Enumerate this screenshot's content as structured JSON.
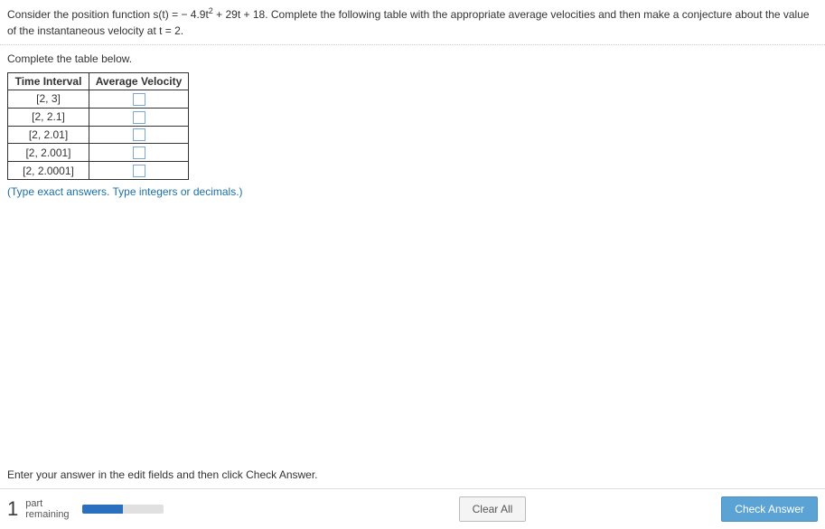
{
  "question": {
    "text_before_sup": "Consider the position function s(t) = − 4.9t",
    "sup": "2",
    "text_after_sup": " + 29t + 18. Complete the following table with the appropriate average velocities and then make a conjecture about the value of the instantaneous velocity at t = 2."
  },
  "instruction": "Complete the table below.",
  "table": {
    "headers": [
      "Time Interval",
      "Average Velocity"
    ],
    "rows": [
      {
        "interval": "[2, 3]"
      },
      {
        "interval": "[2, 2.1]"
      },
      {
        "interval": "[2, 2.01]"
      },
      {
        "interval": "[2, 2.001]"
      },
      {
        "interval": "[2, 2.0001]"
      }
    ]
  },
  "hint": "(Type exact answers. Type integers or decimals.)",
  "footer": {
    "enter_hint": "Enter your answer in the edit fields and then click Check Answer.",
    "part_number": "1",
    "part_label_top": "part",
    "part_label_bottom": "remaining",
    "progress_fill_pct": "50%",
    "clear_all": "Clear All",
    "check_answer": "Check Answer"
  }
}
